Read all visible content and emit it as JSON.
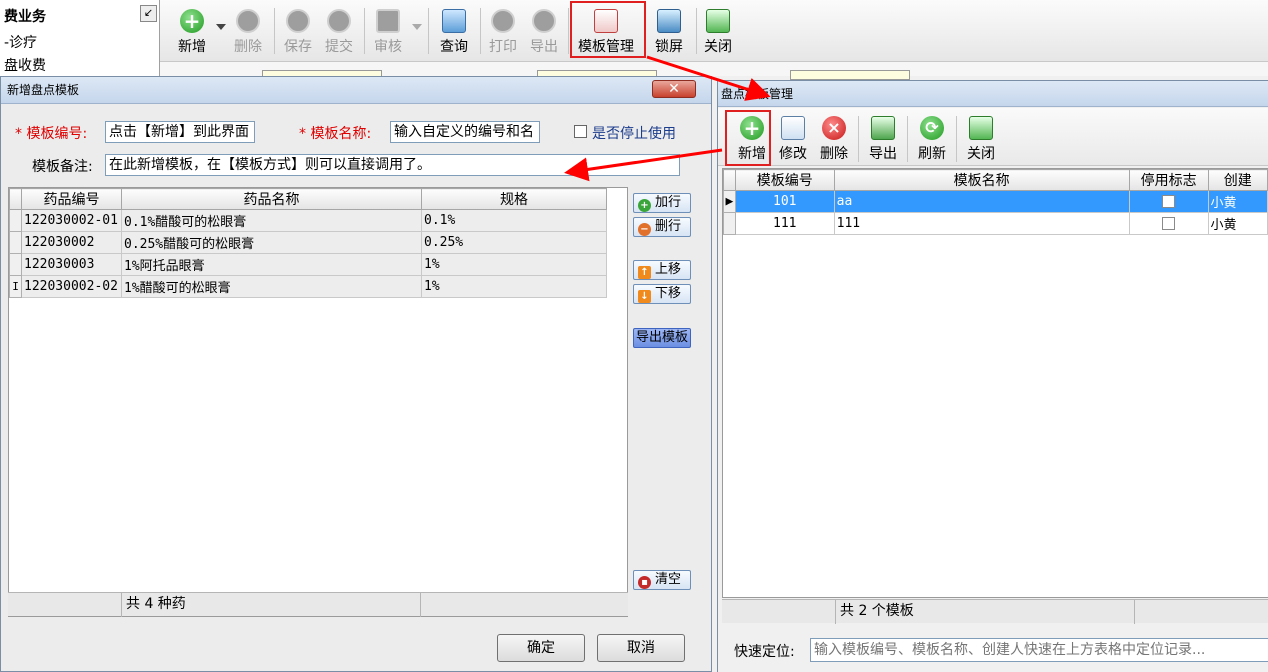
{
  "left_nav": {
    "title": "费业务",
    "items": [
      "-诊疗",
      "盘收费"
    ]
  },
  "main_toolbar": {
    "buttons": [
      {
        "label": "新增",
        "enabled": true
      },
      {
        "label": "删除",
        "enabled": false
      },
      {
        "label": "保存",
        "enabled": false
      },
      {
        "label": "提交",
        "enabled": false
      },
      {
        "label": "审核",
        "enabled": false
      },
      {
        "label": "查询",
        "enabled": true
      },
      {
        "label": "打印",
        "enabled": false
      },
      {
        "label": "导出",
        "enabled": false
      },
      {
        "label": "模板管理",
        "enabled": true
      },
      {
        "label": "锁屏",
        "enabled": true
      },
      {
        "label": "关闭",
        "enabled": true
      }
    ]
  },
  "add_dialog": {
    "title": "新增盘点模板",
    "template_no_label": "模板编号:",
    "template_no_value": "点击【新增】到此界面",
    "template_name_label": "模板名称:",
    "template_name_value": "输入自定义的编号和名",
    "stop_use_label": "是否停止使用",
    "remark_label": "模板备注:",
    "remark_value": "在此新增模板，在【模板方式】则可以直接调用了。",
    "columns": [
      "药品编号",
      "药品名称",
      "规格"
    ],
    "rows": [
      {
        "code": "122030002-01",
        "name": "0.1%醋酸可的松眼膏",
        "spec": "0.1%"
      },
      {
        "code": "122030002",
        "name": "0.25%醋酸可的松眼膏",
        "spec": "0.25%"
      },
      {
        "code": "122030003",
        "name": "1%阿托品眼膏",
        "spec": "1%"
      },
      {
        "code": "122030002-02",
        "name": "1%醋酸可的松眼膏",
        "spec": "1%"
      }
    ],
    "row_indicator": "I",
    "footer_count": "共 4 种药",
    "side_buttons": {
      "add_row": "加行",
      "del_row": "删行",
      "move_up": "上移",
      "move_down": "下移",
      "export": "导出模板",
      "clear": "清空"
    },
    "ok": "确定",
    "cancel": "取消"
  },
  "manage_dialog": {
    "title": "盘点模板管理",
    "toolbar": [
      "新增",
      "修改",
      "删除",
      "导出",
      "刷新",
      "关闭"
    ],
    "columns": [
      "模板编号",
      "模板名称",
      "停用标志",
      "创建"
    ],
    "rows": [
      {
        "no": "101",
        "name": "aa",
        "creator": "小黄",
        "selected": true
      },
      {
        "no": "111",
        "name": "111",
        "creator": "小黄",
        "selected": false
      }
    ],
    "footer_count": "共 2 个模板",
    "quick_locate_label": "快速定位:",
    "quick_locate_placeholder": "输入模板编号、模板名称、创建人快速在上方表格中定位记录..."
  },
  "colors": {
    "highlight": "#e02020",
    "selection": "#3399ff",
    "arrow": "#ff0000"
  }
}
